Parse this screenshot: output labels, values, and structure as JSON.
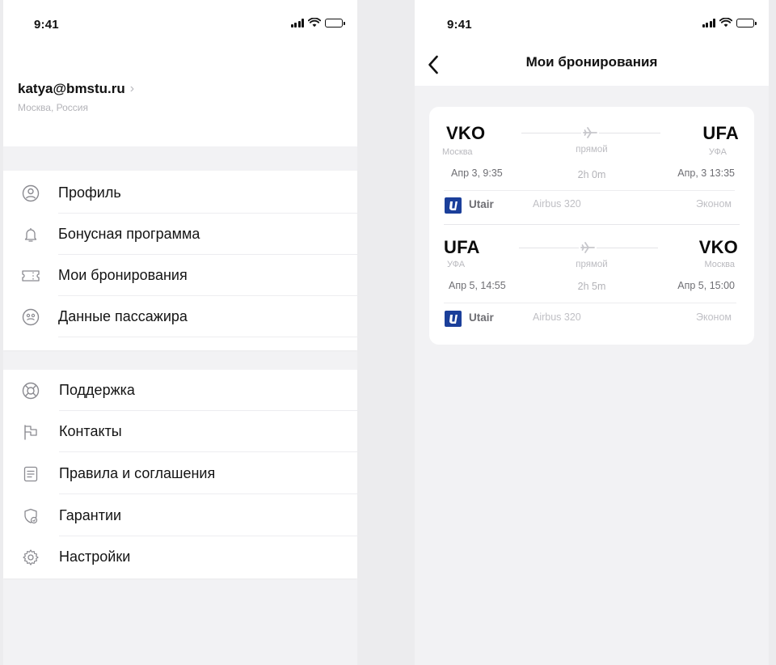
{
  "status_bar": {
    "time": "9:41"
  },
  "profile": {
    "email": "katya@bmstu.ru",
    "chevron": "›",
    "location": "Москва, Россия"
  },
  "menu_group_1": [
    {
      "label": "Профиль",
      "icon": "user-circle-icon"
    },
    {
      "label": "Бонусная программа",
      "icon": "bell-icon"
    },
    {
      "label": "Мои бронирования",
      "icon": "ticket-icon"
    },
    {
      "label": "Данные пассажира",
      "icon": "passenger-face-icon"
    }
  ],
  "menu_group_2": [
    {
      "label": "Поддержка",
      "icon": "lifebuoy-icon"
    },
    {
      "label": "Контакты",
      "icon": "flag-icon"
    },
    {
      "label": "Правила и соглашения",
      "icon": "document-icon"
    },
    {
      "label": "Гарантии",
      "icon": "shield-icon"
    },
    {
      "label": "Настройки",
      "icon": "gear-icon"
    }
  ],
  "bookings_screen": {
    "title": "Мои бронирования",
    "segments": [
      {
        "from_code": "VKO",
        "from_city": "Москва",
        "from_time": "Апр 3, 9:35",
        "to_code": "UFA",
        "to_city": "УФА",
        "to_time": "Апр, 3 13:35",
        "stops": "прямой",
        "duration": "2h 0m",
        "airline": "Utair",
        "aircraft": "Airbus 320",
        "fare_class": "Эконом"
      },
      {
        "from_code": "UFA",
        "from_city": "УФА",
        "from_time": "Апр 5, 14:55",
        "to_code": "VKO",
        "to_city": "Москва",
        "to_time": "Апр 5, 15:00",
        "stops": "прямой",
        "duration": "2h 5m",
        "airline": "Utair",
        "aircraft": "Airbus 320",
        "fare_class": "Эконом"
      }
    ]
  },
  "colors": {
    "brand_utair": "#1b3f9a",
    "background": "#f2f2f4",
    "card": "#ffffff",
    "muted_text": "#b3b3b8"
  }
}
